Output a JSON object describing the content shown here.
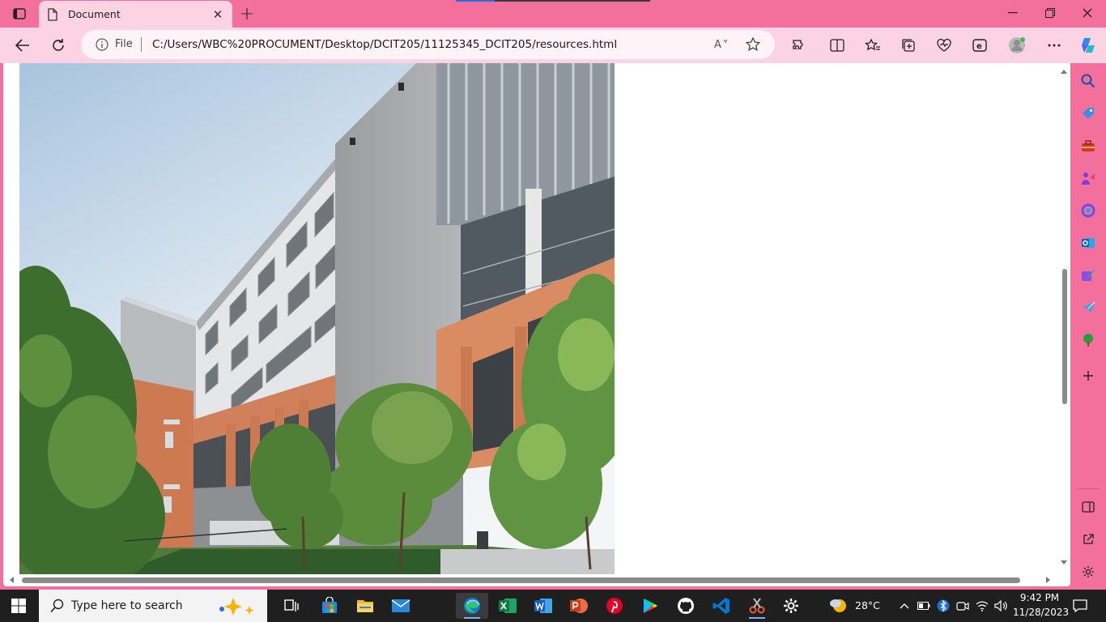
{
  "browser": {
    "tab_title": "Document",
    "address": {
      "scheme_label": "File",
      "url": "C:/Users/WBC%20PROCUMENT/Desktop/DCIT205/11125345_DCIT205/resources.html",
      "read_aloud_label": "Aᴬ"
    },
    "accent_color": "#f4709c",
    "toolbar_color": "#fbd3e2"
  },
  "page": {
    "image_subject": "building-photo"
  },
  "sidebar": {
    "items": [
      "search-icon",
      "tag-icon",
      "toolbox-icon",
      "games-icon",
      "copilot-apps-icon",
      "outlook-icon",
      "designer-icon",
      "send-icon",
      "tree-icon",
      "add-icon"
    ],
    "bottom_items": [
      "split-panel-icon",
      "external-link-icon",
      "settings-icon"
    ]
  },
  "taskbar": {
    "search_placeholder": "Type here to search",
    "weather": "28°C",
    "time": "9:42 PM",
    "date": "11/28/2023",
    "apps": [
      "task-view",
      "microsoft-store",
      "file-explorer",
      "mail",
      "edge",
      "excel",
      "word",
      "powerpoint",
      "pinterest",
      "google-play",
      "github",
      "vscode",
      "snipping-tool",
      "settings"
    ]
  }
}
